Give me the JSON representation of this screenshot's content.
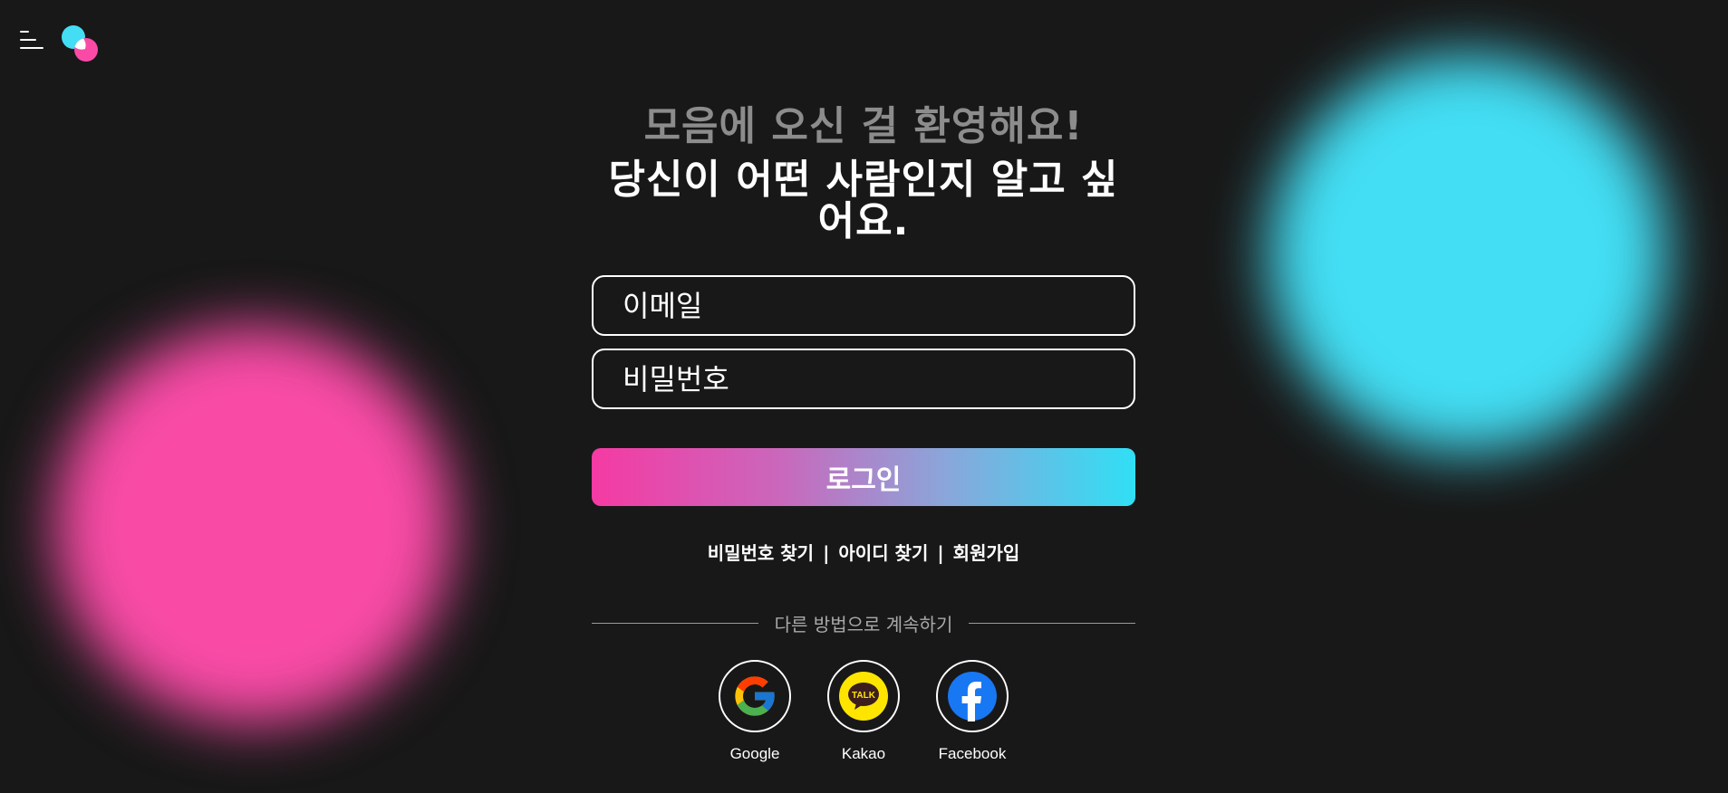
{
  "header": {
    "menu_icon": "hamburger-menu-icon",
    "logo_icon": "overlapping-circles-logo"
  },
  "colors": {
    "background": "#181818",
    "pink": "#f94ba6",
    "cyan": "#43def4",
    "gradient_start": "#f53aa3",
    "gradient_end": "#30dff5",
    "muted_text": "#8c8c8c"
  },
  "welcome": {
    "greeting": "모음에 오신 걸 환영해요!",
    "subtitle": "당신이 어떤 사람인지 알고 싶어요."
  },
  "form": {
    "email_placeholder": "이메일",
    "password_placeholder": "비밀번호",
    "login_label": "로그인"
  },
  "links": {
    "find_password": "비밀번호 찾기",
    "find_id": "아이디 찾기",
    "signup": "회원가입",
    "separator": "|"
  },
  "divider": {
    "text": "다른 방법으로 계속하기"
  },
  "social": {
    "google": {
      "label": "Google",
      "icon": "google-icon"
    },
    "kakao": {
      "label": "Kakao",
      "icon": "kakao-talk-icon",
      "badge": "TALK"
    },
    "facebook": {
      "label": "Facebook",
      "icon": "facebook-icon"
    }
  }
}
